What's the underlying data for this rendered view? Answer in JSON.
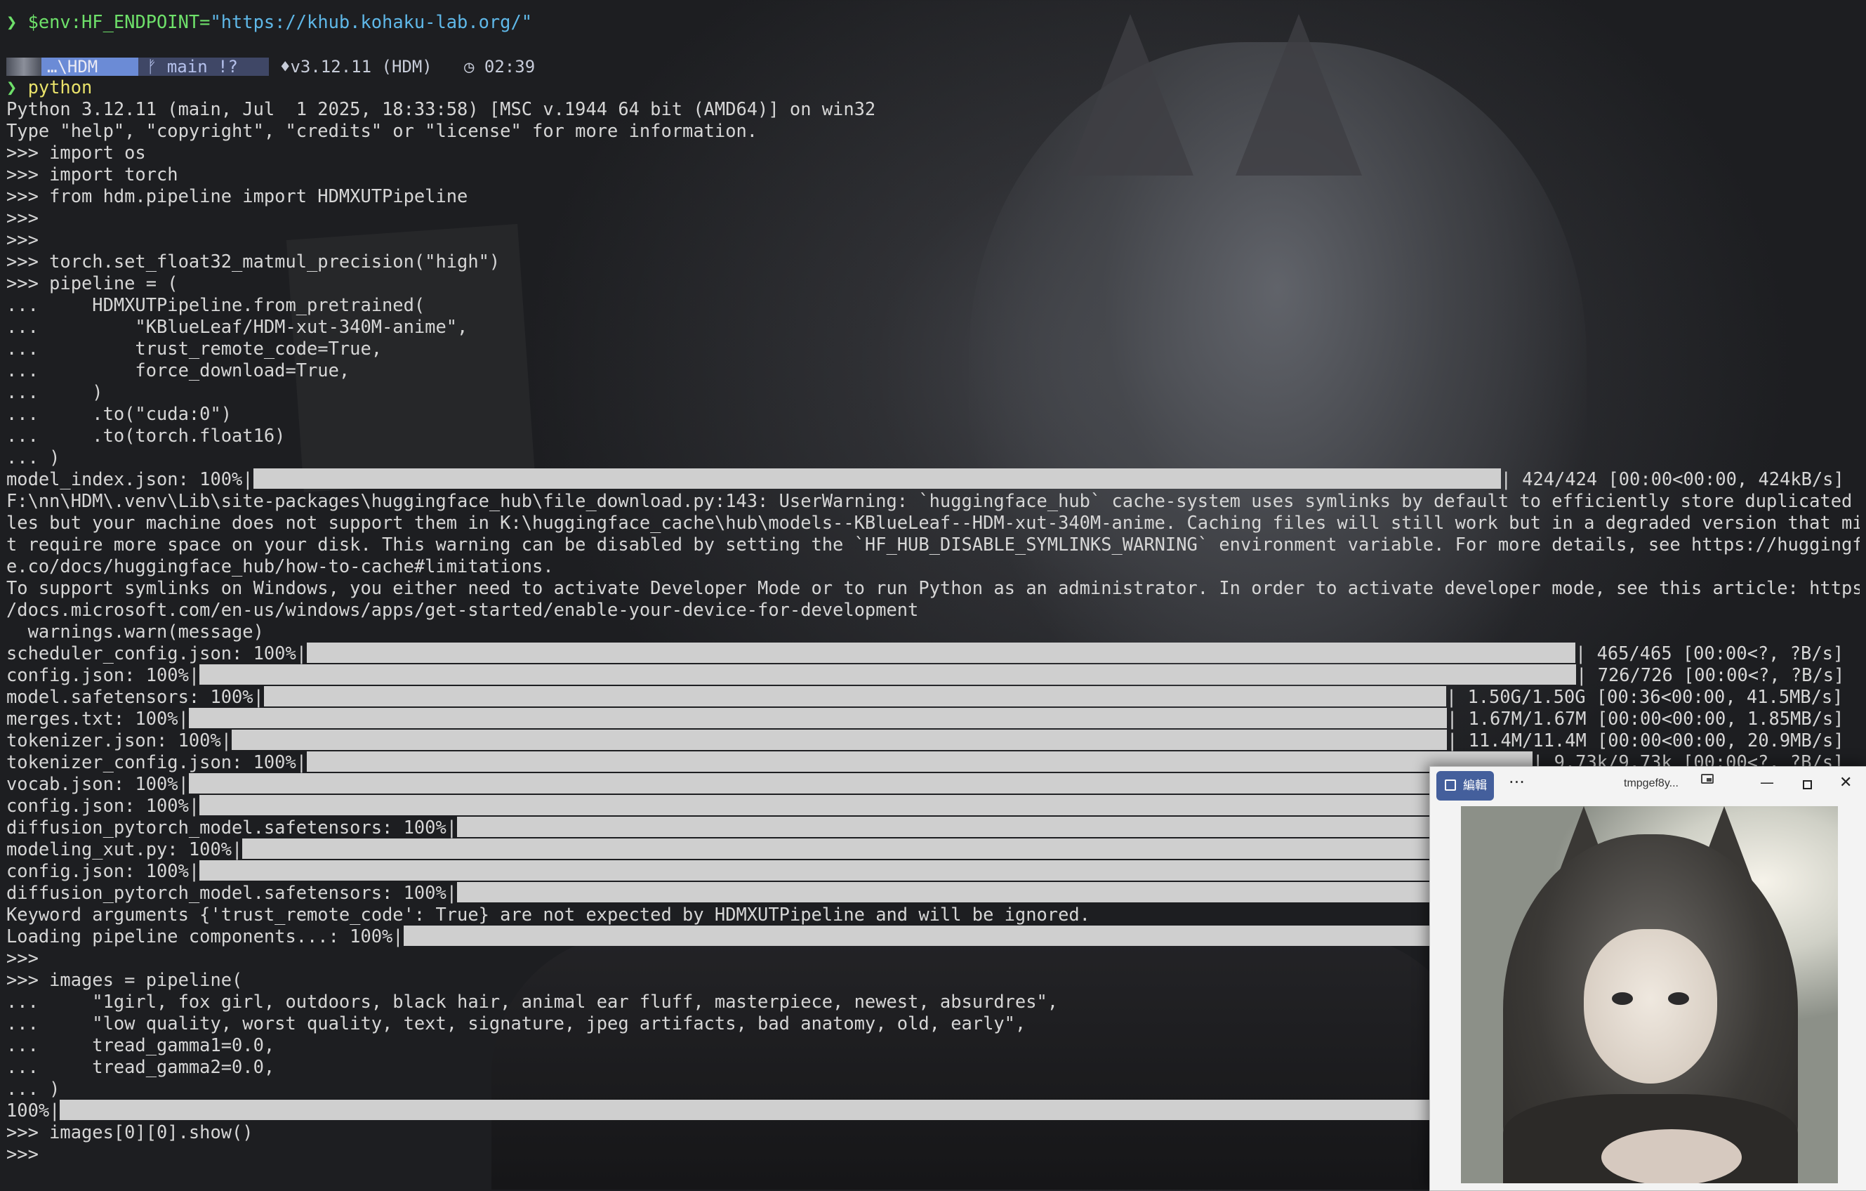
{
  "terminal": {
    "lines": [
      {
        "type": "cmd",
        "prefix": "❯ ",
        "text": "$env:HF_ENDPOINT=",
        "str": "\"https://khub.kohaku-lab.org/\""
      },
      {
        "type": "blank"
      },
      {
        "type": "prompt"
      },
      {
        "type": "cmd2",
        "prefix": "❯ ",
        "text": "python"
      },
      {
        "type": "text",
        "text": "Python 3.12.11 (main, Jul  1 2025, 18:33:58) [MSC v.1944 64 bit (AMD64)] on win32"
      },
      {
        "type": "text",
        "text": "Type \"help\", \"copyright\", \"credits\" or \"license\" for more information."
      },
      {
        "type": "text",
        "text": ">>> import os"
      },
      {
        "type": "text",
        "text": ">>> import torch"
      },
      {
        "type": "text",
        "text": ">>> from hdm.pipeline import HDMXUTPipeline"
      },
      {
        "type": "text",
        "text": ">>>"
      },
      {
        "type": "text",
        "text": ">>>"
      },
      {
        "type": "text",
        "text": ">>> torch.set_float32_matmul_precision(\"high\")"
      },
      {
        "type": "text",
        "text": ">>> pipeline = ("
      },
      {
        "type": "text",
        "text": "...     HDMXUTPipeline.from_pretrained("
      },
      {
        "type": "text",
        "text": "...         \"KBlueLeaf/HDM-xut-340M-anime\","
      },
      {
        "type": "text",
        "text": "...         trust_remote_code=True,"
      },
      {
        "type": "text",
        "text": "...         force_download=True,"
      },
      {
        "type": "text",
        "text": "...     )"
      },
      {
        "type": "text",
        "text": "...     .to(\"cuda:0\")"
      },
      {
        "type": "text",
        "text": "...     .to(torch.float16)"
      },
      {
        "type": "text",
        "text": "... )"
      },
      {
        "type": "progress",
        "label": "model_index.json: 100%|",
        "bar_fraction": 1.0,
        "right": "| 424/424 [00:00<00:00, 424kB/s]"
      },
      {
        "type": "text",
        "text": "F:\\nn\\HDM\\.venv\\Lib\\site-packages\\huggingface_hub\\file_download.py:143: UserWarning: `huggingface_hub` cache-system uses symlinks by default to efficiently store duplicated fi"
      },
      {
        "type": "text",
        "text": "les but your machine does not support them in K:\\huggingface_cache\\hub\\models--KBlueLeaf--HDM-xut-340M-anime. Caching files will still work but in a degraded version that migh"
      },
      {
        "type": "text",
        "text": "t require more space on your disk. This warning can be disabled by setting the `HF_HUB_DISABLE_SYMLINKS_WARNING` environment variable. For more details, see https://huggingfac"
      },
      {
        "type": "text",
        "text": "e.co/docs/huggingface_hub/how-to-cache#limitations."
      },
      {
        "type": "text",
        "text": "To support symlinks on Windows, you either need to activate Developer Mode or to run Python as an administrator. In order to activate developer mode, see this article: https:/"
      },
      {
        "type": "text",
        "text": "/docs.microsoft.com/en-us/windows/apps/get-started/enable-your-device-for-development"
      },
      {
        "type": "text",
        "text": "  warnings.warn(message)"
      },
      {
        "type": "progress",
        "label": "scheduler_config.json: 100%|",
        "bar_fraction": 1.0,
        "right": "| 465/465 [00:00<?, ?B/s]"
      },
      {
        "type": "progress",
        "label": "config.json: 100%|",
        "bar_fraction": 1.0,
        "right": "| 726/726 [00:00<?, ?B/s]"
      },
      {
        "type": "progress",
        "label": "model.safetensors: 100%|",
        "bar_fraction": 1.0,
        "right": "| 1.50G/1.50G [00:36<00:00, 41.5MB/s]"
      },
      {
        "type": "progress",
        "label": "merges.txt: 100%|",
        "bar_fraction": 1.0,
        "right": "| 1.67M/1.67M [00:00<00:00, 1.85MB/s]"
      },
      {
        "type": "progress",
        "label": "tokenizer.json: 100%|",
        "bar_fraction": 1.0,
        "right": "| 11.4M/11.4M [00:00<00:00, 20.9MB/s]"
      },
      {
        "type": "progress",
        "label": "tokenizer_config.json: 100%|",
        "bar_fraction": 1.0,
        "right": "| 9.73k/9.73k [00:00<?, ?B/s]"
      },
      {
        "type": "progress",
        "label": "vocab.json: 100%|",
        "bar_fraction": 1.0,
        "right": ""
      },
      {
        "type": "progress",
        "label": "config.json: 100%|",
        "bar_fraction": 1.0,
        "right": ""
      },
      {
        "type": "progress",
        "label": "diffusion_pytorch_model.safetensors: 100%|",
        "bar_fraction": 1.0,
        "right": ""
      },
      {
        "type": "progress",
        "label": "modeling_xut.py: 100%|",
        "bar_fraction": 1.0,
        "right": ""
      },
      {
        "type": "progress",
        "label": "config.json: 100%|",
        "bar_fraction": 1.0,
        "right": ""
      },
      {
        "type": "progress",
        "label": "diffusion_pytorch_model.safetensors: 100%|",
        "bar_fraction": 1.0,
        "right": ""
      },
      {
        "type": "text",
        "text": "Keyword arguments {'trust_remote_code': True} are not expected by HDMXUTPipeline and will be ignored."
      },
      {
        "type": "progress",
        "label": "Loading pipeline components...: 100%|",
        "bar_fraction": 1.0,
        "right": ""
      },
      {
        "type": "text",
        "text": ">>>"
      },
      {
        "type": "text",
        "text": ">>> images = pipeline("
      },
      {
        "type": "text",
        "text": "...     \"1girl, fox girl, outdoors, black hair, animal ear fluff, masterpiece, newest, absurdres\","
      },
      {
        "type": "text",
        "text": "...     \"low quality, worst quality, text, signature, jpeg artifacts, bad anatomy, old, early\","
      },
      {
        "type": "text",
        "text": "...     tread_gamma1=0.0,"
      },
      {
        "type": "text",
        "text": "...     tread_gamma2=0.0,"
      },
      {
        "type": "text",
        "text": "... )"
      },
      {
        "type": "progress",
        "label": "100%|",
        "bar_fraction": 1.0,
        "right": ""
      },
      {
        "type": "text",
        "text": ">>> images[0][0].show()"
      },
      {
        "type": "text",
        "text": ">>>"
      }
    ]
  },
  "prompt_bar": {
    "path": "…\\HDM",
    "git": "ᚠ main !?",
    "python": "♦v3.12.11 (HDM)",
    "time": "◷ 02:39"
  },
  "viewer": {
    "edit_label": "編輯",
    "more": "···",
    "title": "tmpgef8y...",
    "minimize": "—",
    "close": "✕",
    "image": "generated-anime-fox-girl-image"
  }
}
